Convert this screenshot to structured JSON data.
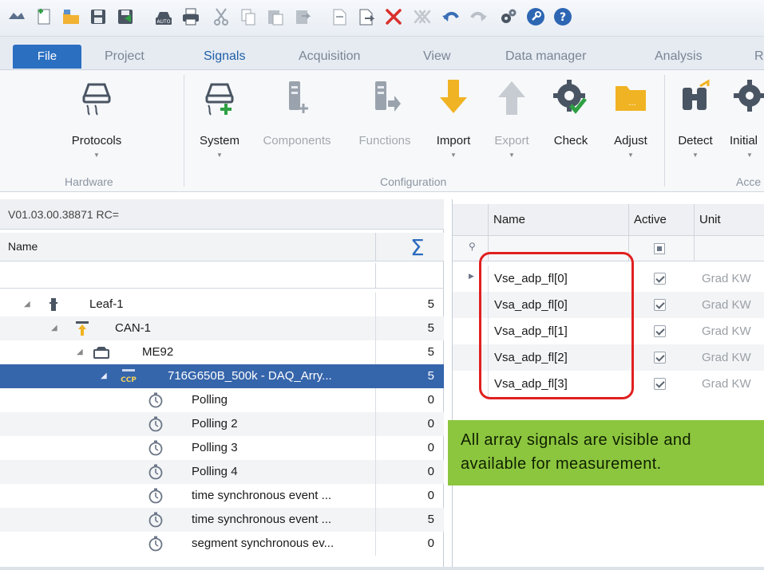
{
  "tabs": [
    {
      "label": "File"
    },
    {
      "label": "Project"
    },
    {
      "label": "Signals"
    },
    {
      "label": "Acquisition"
    },
    {
      "label": "View"
    },
    {
      "label": "Data manager"
    },
    {
      "label": "Analysis"
    },
    {
      "label": "R"
    }
  ],
  "ribbon": {
    "buttons": [
      {
        "label": "Protocols",
        "icon": "protocols-icon"
      },
      {
        "label": "System",
        "icon": "system-add-icon"
      },
      {
        "label": "Components",
        "icon": "components-icon"
      },
      {
        "label": "Functions",
        "icon": "functions-icon"
      },
      {
        "label": "Import",
        "icon": "import-arrow-icon"
      },
      {
        "label": "Export",
        "icon": "export-arrow-icon"
      },
      {
        "label": "Check",
        "icon": "check-gear-icon"
      },
      {
        "label": "Adjust",
        "icon": "folder-icon"
      },
      {
        "label": "Detect",
        "icon": "binoculars-icon"
      },
      {
        "label": "Initial",
        "icon": "gear-icon"
      }
    ],
    "groups": [
      "Hardware",
      "Configuration",
      "Acce"
    ]
  },
  "left_panel": {
    "version": "V01.03.00.38871 RC=",
    "header_name": "Name",
    "tree": [
      {
        "name": "Leaf-1",
        "count": "5"
      },
      {
        "name": "CAN-1",
        "count": "5"
      },
      {
        "name": "ME92",
        "count": "5"
      },
      {
        "name": "716G650B_500k - DAQ_Arry...",
        "count": "5",
        "tag": "CCP"
      },
      {
        "name": "Polling",
        "count": "0"
      },
      {
        "name": "Polling 2",
        "count": "0"
      },
      {
        "name": "Polling 3",
        "count": "0"
      },
      {
        "name": "Polling 4",
        "count": "0"
      },
      {
        "name": "time synchronous event ...",
        "count": "0"
      },
      {
        "name": "time synchronous event ...",
        "count": "5"
      },
      {
        "name": "segment synchronous ev...",
        "count": "0"
      }
    ]
  },
  "right_panel": {
    "columns": [
      "Name",
      "Active",
      "Unit"
    ],
    "rows": [
      {
        "name": "Vse_adp_fl[0]",
        "unit": "Grad KW"
      },
      {
        "name": "Vsa_adp_fl[0]",
        "unit": "Grad KW"
      },
      {
        "name": "Vsa_adp_fl[1]",
        "unit": "Grad KW"
      },
      {
        "name": "Vsa_adp_fl[2]",
        "unit": "Grad KW"
      },
      {
        "name": "Vsa_adp_fl[3]",
        "unit": "Grad KW"
      }
    ]
  },
  "callout": {
    "line1": "All array signals are visible and",
    "line2": "available for measurement."
  },
  "colors": {
    "file_tab": "#2b6fc1",
    "selected_row": "#3565ab",
    "highlight_outline": "#e02020",
    "callout_bg": "#8cc63f",
    "import_arrow": "#f0b323"
  }
}
